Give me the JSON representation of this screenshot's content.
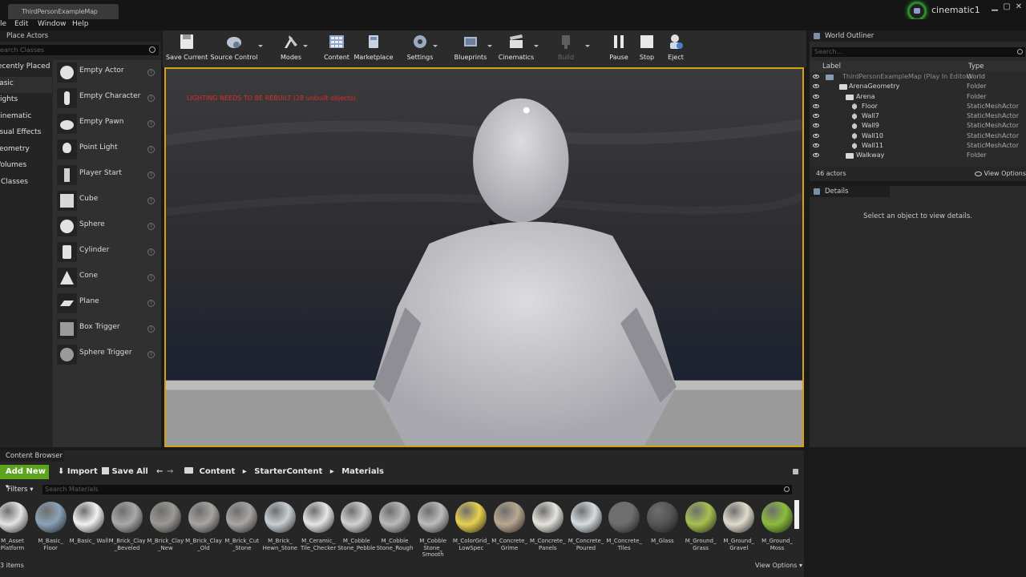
{
  "titlebar": {
    "tab": "ThirdPersonExampleMap",
    "project": "cinematic1",
    "minimize": "▁",
    "maximize": "▢",
    "close": "✕"
  },
  "menu": [
    "le",
    "Edit",
    "Window",
    "Help"
  ],
  "place_actors": {
    "title": "Place Actors",
    "search_placeholder": "earch Classes",
    "categories": [
      "Recently Placed",
      "Basic",
      "Lights",
      "Cinematic",
      "Visual Effects",
      "Geometry",
      "Volumes",
      "All Classes"
    ],
    "items": [
      "Empty Actor",
      "Empty Character",
      "Empty Pawn",
      "Point Light",
      "Player Start",
      "Cube",
      "Sphere",
      "Cylinder",
      "Cone",
      "Plane",
      "Box Trigger",
      "Sphere Trigger"
    ]
  },
  "toolbar": {
    "save_current": "Save Current",
    "source_control": "Source Control",
    "modes": "Modes",
    "content": "Content",
    "marketplace": "Marketplace",
    "settings": "Settings",
    "blueprints": "Blueprints",
    "cinematics": "Cinematics",
    "build": "Build",
    "pause": "Pause",
    "stop": "Stop",
    "eject": "Eject"
  },
  "viewport": {
    "warning": "LIGHTING NEEDS TO BE REBUILT (28 unbuilt objects)"
  },
  "world_outliner": {
    "title": "World Outliner",
    "search_placeholder": "Search...",
    "col_label": "Label",
    "col_type": "Type",
    "rows": [
      {
        "label": "ThirdPersonExampleMap (Play In Editor)",
        "type": "World"
      },
      {
        "label": "ArenaGeometry",
        "type": "Folder"
      },
      {
        "label": "Arena",
        "type": "Folder"
      },
      {
        "label": "Floor",
        "type": "StaticMeshActor"
      },
      {
        "label": "Wall7",
        "type": "StaticMeshActor"
      },
      {
        "label": "Wall9",
        "type": "StaticMeshActor"
      },
      {
        "label": "Wall10",
        "type": "StaticMeshActor"
      },
      {
        "label": "Wall11",
        "type": "StaticMeshActor"
      },
      {
        "label": "Walkway",
        "type": "Folder"
      }
    ],
    "count": "46 actors",
    "view_options": "View Options"
  },
  "details": {
    "title": "Details",
    "message": "Select an object to view details."
  },
  "content_browser": {
    "title": "Content Browser",
    "add_new": "Add New",
    "import": "Import",
    "save_all": "Save All",
    "path": [
      "Content",
      "StarterContent",
      "Materials"
    ],
    "filters": "Filters",
    "search_placeholder": "Search Materials",
    "assets": [
      {
        "name": "M_Asset Platform",
        "color": "#e4e4e4"
      },
      {
        "name": "M_Basic_ Floor",
        "color": "#8aa2b8"
      },
      {
        "name": "M_Basic_ Wall",
        "color": "#f2f2f2"
      },
      {
        "name": "M_Brick_Clay _Beveled",
        "color": "#a9a9a9"
      },
      {
        "name": "M_Brick_Clay _New",
        "color": "#9c9994"
      },
      {
        "name": "M_Brick_Clay _Old",
        "color": "#a7a5a1"
      },
      {
        "name": "M_Brick_Cut _Stone",
        "color": "#a8a6a3"
      },
      {
        "name": "M_Brick_ Hewn_Stone",
        "color": "#c9cfd4"
      },
      {
        "name": "M_Ceramic_ Tile_Checker",
        "color": "#e6e6e6"
      },
      {
        "name": "M_Cobble Stone_Pebble",
        "color": "#d2d2d2"
      },
      {
        "name": "M_Cobble Stone_Rough",
        "color": "#bababa"
      },
      {
        "name": "M_Cobble Stone_ Smooth",
        "color": "#bcbcbc"
      },
      {
        "name": "M_ColorGrid_ LowSpec",
        "color": "#e8d050"
      },
      {
        "name": "M_Concrete_ Grime",
        "color": "#b8a890"
      },
      {
        "name": "M_Concrete_ Panels",
        "color": "#e6e4de"
      },
      {
        "name": "M_Concrete_ Poured",
        "color": "#d6dce0"
      },
      {
        "name": "M_Concrete_ Tiles",
        "color": "#6e6e6e"
      },
      {
        "name": "M_Glass",
        "color": "#555555"
      },
      {
        "name": "M_Ground_ Grass",
        "color": "#a8c050"
      },
      {
        "name": "M_Ground_ Gravel",
        "color": "#e0dccc"
      },
      {
        "name": "M_Ground_ Moss",
        "color": "#8cbc3c"
      }
    ],
    "count": "3 items",
    "view_options": "View Options"
  },
  "colors": {
    "viewport_border": "#d6a310",
    "add_new": "#5da41e",
    "warning": "#e02a2a"
  }
}
